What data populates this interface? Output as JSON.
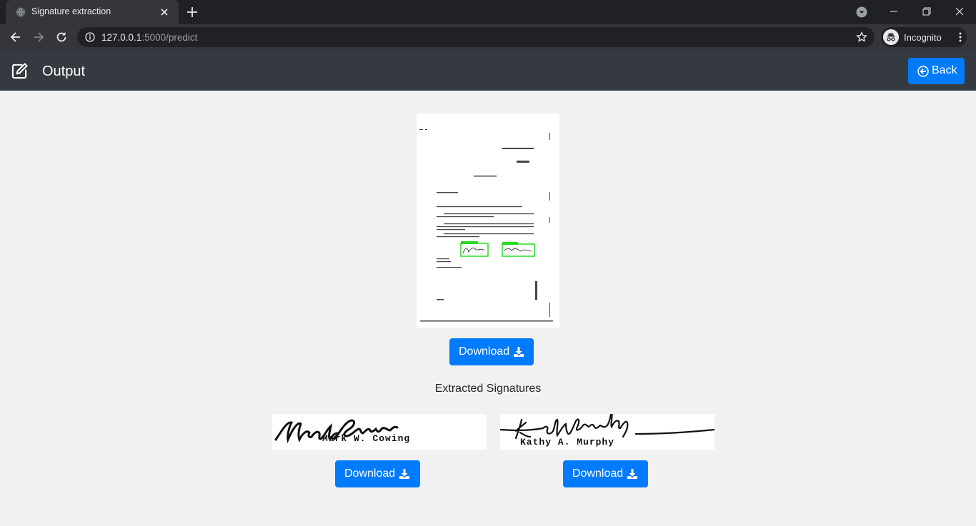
{
  "browser": {
    "tab_title": "Signature extraction",
    "url_host": "127.0.0.1",
    "url_rest": ":5000/predict",
    "profile_label": "Incognito"
  },
  "navbar": {
    "title": "Output",
    "back_label": "Back"
  },
  "main": {
    "download_label": "Download",
    "section_title": "Extracted Signatures",
    "signatures": [
      {
        "printed_name": "Mark W. Cowing",
        "download_label": "Download"
      },
      {
        "printed_name": "Kathy A. Murphy",
        "download_label": "Download"
      }
    ]
  },
  "colors": {
    "primary": "#007bff",
    "navbar": "#343a40",
    "background": "#f1f1f1",
    "detection_box": "#22dd22"
  },
  "icons": [
    "edit-icon",
    "arrow-circle-left-icon",
    "download-icon",
    "incognito-icon",
    "star-icon",
    "info-icon"
  ]
}
